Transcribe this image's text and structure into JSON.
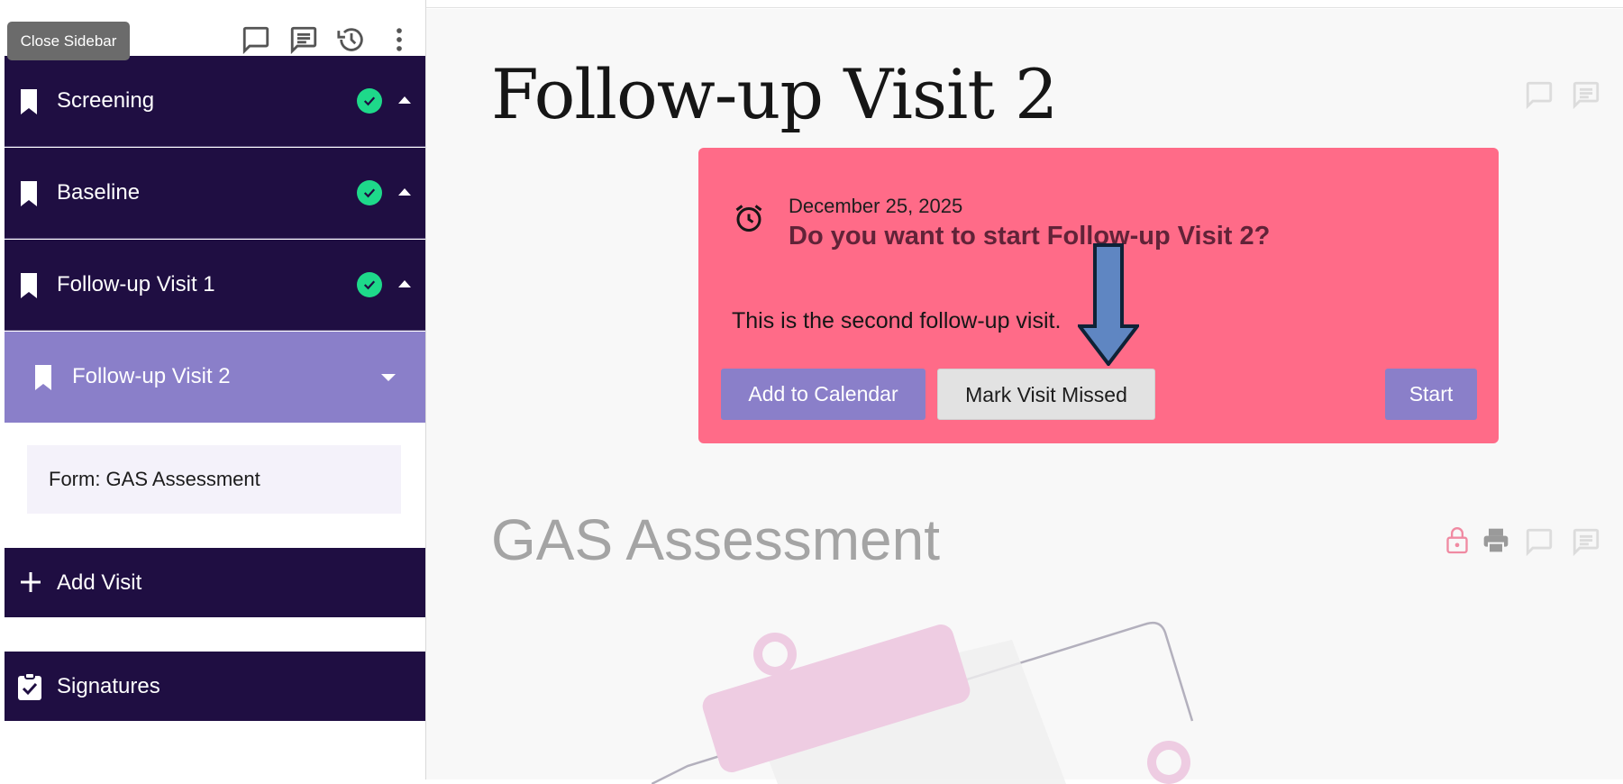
{
  "sidebar": {
    "tooltip": "Close Sidebar",
    "toolbar_icons": [
      "comment-icon",
      "comments-list-icon",
      "history-icon",
      "more-vert-icon"
    ],
    "visits": [
      {
        "label": "Screening",
        "completed": true
      },
      {
        "label": "Baseline",
        "completed": true
      },
      {
        "label": "Follow-up Visit 1",
        "completed": true
      }
    ],
    "active_visit": {
      "label": "Follow-up Visit 2",
      "expanded": true
    },
    "form_item": "Form: GAS Assessment",
    "add_visit": "Add Visit",
    "signatures": "Signatures",
    "colors": {
      "dark": "#1f0e42",
      "active": "#8a7fc9",
      "check": "#1ed98a"
    }
  },
  "main": {
    "page_title": "Follow-up Visit 2",
    "card": {
      "date": "December 25, 2025",
      "question": "Do you want to start Follow-up Visit 2?",
      "description": "This is the second follow-up visit.",
      "add_calendar": "Add to Calendar",
      "mark_missed": "Mark Visit Missed",
      "start": "Start",
      "color": "#ff6b88"
    },
    "form_title": "GAS Assessment",
    "form_icons": [
      "lock-icon",
      "print-icon",
      "comment-icon",
      "comments-list-icon"
    ]
  }
}
